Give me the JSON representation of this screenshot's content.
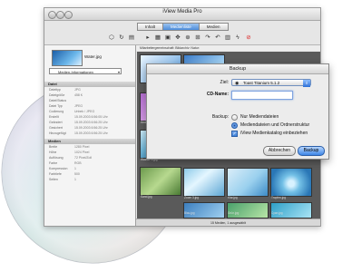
{
  "window": {
    "title": "iView Media Pro"
  },
  "tabs": [
    {
      "label": "Inhalt"
    },
    {
      "label": "Medienliste"
    },
    {
      "label": "Medien"
    }
  ],
  "toolbar": {
    "icons": [
      "tag-icon",
      "refresh-icon",
      "trash-icon",
      "separator",
      "slideshow-icon",
      "grid-icon",
      "frame-icon",
      "expand-icon",
      "target-icon",
      "zoom-icon",
      "rotate-icon",
      "rotate-back-icon",
      "backup-icon",
      "lightning-icon",
      "stop-icon"
    ]
  },
  "sidebar": {
    "thumbnail_name": "Water.jpg",
    "panel_select": "Medien-Informationen",
    "section_file": "Datei",
    "file_fields": [
      {
        "k": "Dateityp",
        "v": "JPG"
      },
      {
        "k": "Dateigröße",
        "v": "458 K"
      },
      {
        "k": "Datei/Status",
        "v": ""
      },
      {
        "k": "Datei Typ",
        "v": "JPEG"
      },
      {
        "k": "Codierung",
        "v": "Unbek / JPEG"
      },
      {
        "k": "Erstellt",
        "v": "15.09.2003 6:56:05 Uhr"
      },
      {
        "k": "Geändert",
        "v": "15.09.2003 6:56:25 Uhr"
      },
      {
        "k": "Gesichert",
        "v": "15.09.2003 6:56:25 Uhr"
      },
      {
        "k": "Hinzugefügt",
        "v": "15.09.2003 6:56:25 Uhr"
      }
    ],
    "section_media": "Medien",
    "media_fields": [
      {
        "k": "Breite",
        "v": "1280 Pixel"
      },
      {
        "k": "Höhe",
        "v": "1024 Pixel"
      },
      {
        "k": "Auflösung",
        "v": "72 Pixel/Zoll"
      },
      {
        "k": "Farbe",
        "v": "RGB"
      },
      {
        "k": "Kompression",
        "v": "1"
      },
      {
        "k": "Farbtiefe",
        "v": "500"
      },
      {
        "k": "Seiten",
        "v": "1"
      }
    ]
  },
  "content": {
    "header": "Mitarbeitergemeinschaft: Bildarchiv: Natur:",
    "captions": [
      "Herbst 1.jpg",
      "Wasser 1.jpg",
      "Zoom 3.jpg",
      "Klar.jpg",
      "Tropfen.jpg",
      "Blau.jpg",
      "Grün.jpg",
      "Cyan.jpg",
      "Sand.jpg"
    ],
    "status": "15 Medien, 1 ausgewählt"
  },
  "dialog": {
    "title": "Backup",
    "ziel_label": "Ziel:",
    "ziel_value": "Toast Titanium 5.1.2",
    "cd_label": "CD-Name:",
    "cd_value": "",
    "backup_label": "Backup:",
    "options": [
      {
        "label": "Nur Mediendateien",
        "selected": false
      },
      {
        "label": "Mediendateien und Ordnerstruktur",
        "selected": true
      }
    ],
    "checkbox_label": "iView Medienkatalog einbeziehen",
    "checkbox_checked": true,
    "cancel_label": "Abbrechen",
    "ok_label": "Backup"
  },
  "colors": {
    "accent": "#3d86e6",
    "tab_active": "#4d8ddb"
  }
}
